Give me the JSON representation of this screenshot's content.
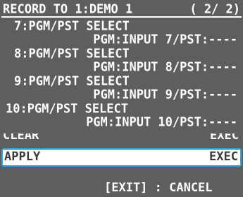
{
  "header": {
    "title": "RECORD TO 1:DEMO 1",
    "page": "( 2/ 2)"
  },
  "items": [
    {
      "name": "7:PGM/PST SELECT",
      "detail": "PGM:INPUT 7/PST:----"
    },
    {
      "name": "8:PGM/PST SELECT",
      "detail": "PGM:INPUT 8/PST:----"
    },
    {
      "name": "9:PGM/PST SELECT",
      "detail": "PGM:INPUT 9/PST:----"
    },
    {
      "name": "10:PGM/PST SELECT",
      "detail": "PGM:INPUT 10/PST:----"
    }
  ],
  "clear_row": {
    "label": "CLEAR",
    "value": "EXEC"
  },
  "apply_row": {
    "label": "APPLY",
    "value": "EXEC"
  },
  "footer": {
    "hint": "[EXIT] : CANCEL"
  },
  "colors": {
    "background": "#5e5e5e",
    "text": "#ffffff",
    "selected_background": "#ffffff",
    "selected_text": "#3a3a3a",
    "selected_border": "#2fa6e0"
  }
}
